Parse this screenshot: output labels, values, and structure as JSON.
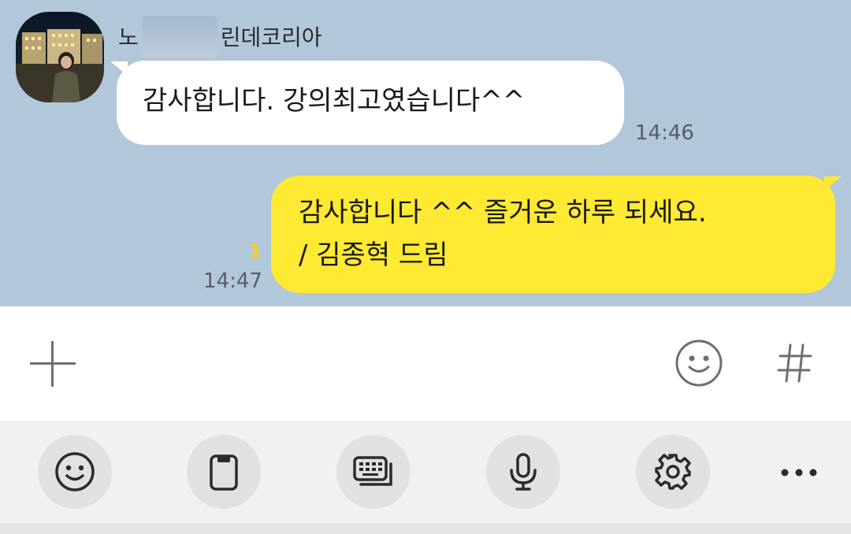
{
  "chat": {
    "incoming": {
      "sender_prefix": "노",
      "sender_suffix": "린데코리아",
      "message": "감사합니다. 강의최고였습니다^^",
      "time": "14:46"
    },
    "outgoing": {
      "line1": "감사합니다 ^^ 즐거운 하루 되세요.",
      "line2": "/ 김종혁 드림",
      "unread_count": "1",
      "time": "14:47"
    }
  },
  "input_bar": {
    "icons": [
      "plus-icon",
      "emoticon-icon",
      "hashtag-icon"
    ]
  },
  "keyboard_toolbar": {
    "icons": [
      "emoji-icon",
      "clipboard-icon",
      "keyboard-mode-icon",
      "microphone-icon",
      "settings-icon",
      "more-icon"
    ]
  },
  "colors": {
    "chat_background": "#b2c7da",
    "incoming_bubble": "#ffffff",
    "outgoing_bubble": "#fee933",
    "unread_badge": "#f5cf24",
    "toolbar_background": "#f1f1f3",
    "toolbar_button": "#e1e1e3"
  }
}
